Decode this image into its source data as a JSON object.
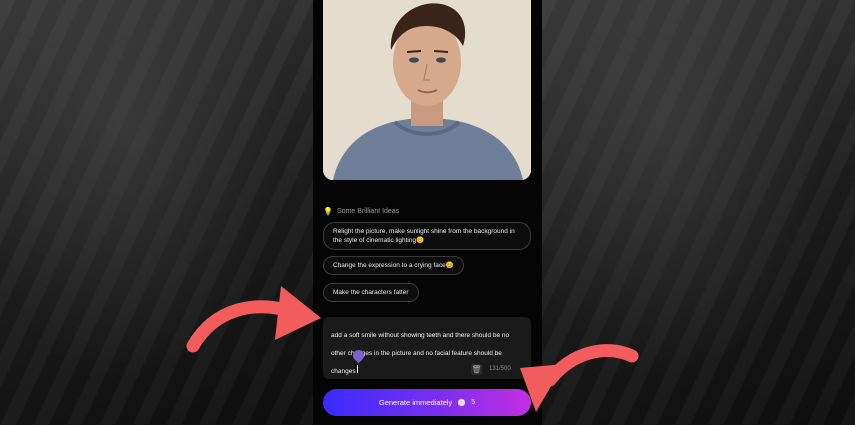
{
  "ideas": {
    "header": "Some Brilliant Ideas",
    "chips": [
      "Relight the picture, make sunlight shine from the background in the style of cinematic lighting😊",
      "Change the expression to a crying face😊",
      "Make the characters fatter"
    ]
  },
  "prompt": {
    "text": "add a soft smile without showing teeth and there should be no other changes in the picture and no facial feature should be changes",
    "char_count": "131/500"
  },
  "generate": {
    "label": "Generate immediately",
    "cost": "5"
  },
  "icons": {
    "ideas": "lightbulb-icon",
    "delete": "trash-icon",
    "credits": "coin-icon",
    "annotation": "curved-arrow-icon"
  },
  "colors": {
    "accent_start": "#3a2bff",
    "accent_end": "#c42ee0",
    "annotation_arrow": "#f25c5c"
  }
}
